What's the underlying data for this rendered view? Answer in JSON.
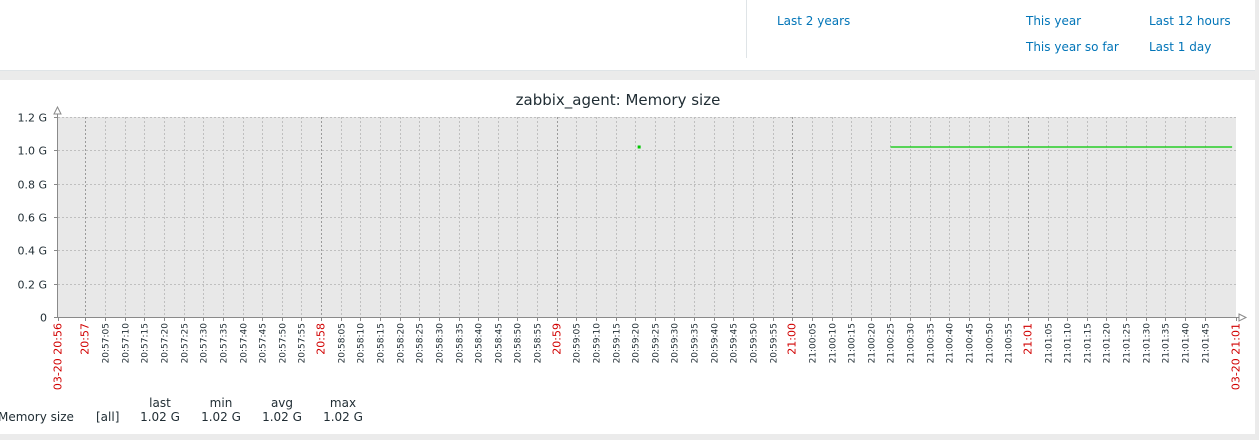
{
  "time_links": {
    "last_2_years": "Last 2 years",
    "this_year": "This year",
    "this_year_so_far": "This year so far",
    "last_12_hours": "Last 12 hours",
    "last_1_day": "Last 1 day"
  },
  "legend": {
    "item": "Memory size",
    "function": "[all]",
    "headers": [
      "last",
      "min",
      "avg",
      "max"
    ],
    "values": [
      "1.02 G",
      "1.02 G",
      "1.02 G",
      "1.02 G"
    ]
  },
  "colors": {
    "series": "#00c800",
    "plot_bg": "#e8e8e8",
    "grid": "#bfbfbf",
    "major_tick": "#d10000",
    "link": "#0275b8"
  },
  "chart_data": {
    "type": "line",
    "title": "zabbix_agent: Memory size",
    "xlabel": "",
    "ylabel": "",
    "ylim": [
      0,
      1.2
    ],
    "y_ticks": [
      0,
      0.2,
      0.4,
      0.6,
      0.8,
      1.0,
      1.2
    ],
    "y_tick_labels": [
      "0",
      "0.2 G",
      "0.4 G",
      "0.6 G",
      "0.8 G",
      "1.0 G",
      "1.2 G"
    ],
    "x_range": [
      "20:56:53",
      "21:01:53"
    ],
    "x_ticks": [
      {
        "label": "03-20 20:56",
        "time": "20:56:53",
        "major": true
      },
      {
        "label": "20:57",
        "time": "20:57:00",
        "major": true
      },
      {
        "label": "20:57:05",
        "time": "20:57:05"
      },
      {
        "label": "20:57:10",
        "time": "20:57:10"
      },
      {
        "label": "20:57:15",
        "time": "20:57:15"
      },
      {
        "label": "20:57:20",
        "time": "20:57:20"
      },
      {
        "label": "20:57:25",
        "time": "20:57:25"
      },
      {
        "label": "20:57:30",
        "time": "20:57:30"
      },
      {
        "label": "20:57:35",
        "time": "20:57:35"
      },
      {
        "label": "20:57:40",
        "time": "20:57:40"
      },
      {
        "label": "20:57:45",
        "time": "20:57:45"
      },
      {
        "label": "20:57:50",
        "time": "20:57:50"
      },
      {
        "label": "20:57:55",
        "time": "20:57:55"
      },
      {
        "label": "20:58",
        "time": "20:58:00",
        "major": true
      },
      {
        "label": "20:58:05",
        "time": "20:58:05"
      },
      {
        "label": "20:58:10",
        "time": "20:58:10"
      },
      {
        "label": "20:58:15",
        "time": "20:58:15"
      },
      {
        "label": "20:58:20",
        "time": "20:58:20"
      },
      {
        "label": "20:58:25",
        "time": "20:58:25"
      },
      {
        "label": "20:58:30",
        "time": "20:58:30"
      },
      {
        "label": "20:58:35",
        "time": "20:58:35"
      },
      {
        "label": "20:58:40",
        "time": "20:58:40"
      },
      {
        "label": "20:58:45",
        "time": "20:58:45"
      },
      {
        "label": "20:58:50",
        "time": "20:58:50"
      },
      {
        "label": "20:58:55",
        "time": "20:58:55"
      },
      {
        "label": "20:59",
        "time": "20:59:00",
        "major": true
      },
      {
        "label": "20:59:05",
        "time": "20:59:05"
      },
      {
        "label": "20:59:10",
        "time": "20:59:10"
      },
      {
        "label": "20:59:15",
        "time": "20:59:15"
      },
      {
        "label": "20:59:20",
        "time": "20:59:20"
      },
      {
        "label": "20:59:25",
        "time": "20:59:25"
      },
      {
        "label": "20:59:30",
        "time": "20:59:30"
      },
      {
        "label": "20:59:35",
        "time": "20:59:35"
      },
      {
        "label": "20:59:40",
        "time": "20:59:40"
      },
      {
        "label": "20:59:45",
        "time": "20:59:45"
      },
      {
        "label": "20:59:50",
        "time": "20:59:50"
      },
      {
        "label": "20:59:55",
        "time": "20:59:55"
      },
      {
        "label": "21:00",
        "time": "21:00:00",
        "major": true
      },
      {
        "label": "21:00:05",
        "time": "21:00:05"
      },
      {
        "label": "21:00:10",
        "time": "21:00:10"
      },
      {
        "label": "21:00:15",
        "time": "21:00:15"
      },
      {
        "label": "21:00:20",
        "time": "21:00:20"
      },
      {
        "label": "21:00:25",
        "time": "21:00:25"
      },
      {
        "label": "21:00:30",
        "time": "21:00:30"
      },
      {
        "label": "21:00:35",
        "time": "21:00:35"
      },
      {
        "label": "21:00:40",
        "time": "21:00:40"
      },
      {
        "label": "21:00:45",
        "time": "21:00:45"
      },
      {
        "label": "21:00:50",
        "time": "21:00:50"
      },
      {
        "label": "21:00:55",
        "time": "21:00:55"
      },
      {
        "label": "21:01",
        "time": "21:01:00",
        "major": true
      },
      {
        "label": "21:01:05",
        "time": "21:01:05"
      },
      {
        "label": "21:01:10",
        "time": "21:01:10"
      },
      {
        "label": "21:01:15",
        "time": "21:01:15"
      },
      {
        "label": "21:01:20",
        "time": "21:01:20"
      },
      {
        "label": "21:01:25",
        "time": "21:01:25"
      },
      {
        "label": "21:01:30",
        "time": "21:01:30"
      },
      {
        "label": "21:01:35",
        "time": "21:01:35"
      },
      {
        "label": "21:01:40",
        "time": "21:01:40"
      },
      {
        "label": "21:01:45",
        "time": "21:01:45"
      },
      {
        "label": "03-20 21:01",
        "time": "21:01:53",
        "major": true
      }
    ],
    "series": [
      {
        "name": "Memory size",
        "points": [
          {
            "x": "20:59:21",
            "y": 1.02
          },
          {
            "x": "21:00:25",
            "y": 1.02
          },
          {
            "x": "21:01:52",
            "y": 1.02
          }
        ],
        "segments": [
          [
            0,
            0
          ],
          [
            1,
            2
          ]
        ]
      }
    ]
  }
}
